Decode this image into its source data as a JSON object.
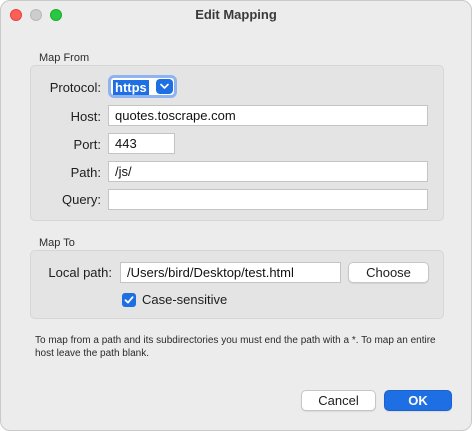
{
  "window": {
    "title": "Edit Mapping"
  },
  "map_from": {
    "section_label": "Map From",
    "protocol": {
      "label": "Protocol:",
      "value": "https"
    },
    "host": {
      "label": "Host:",
      "value": "quotes.toscrape.com"
    },
    "port": {
      "label": "Port:",
      "value": "443"
    },
    "path": {
      "label": "Path:",
      "value": "/js/"
    },
    "query": {
      "label": "Query:",
      "value": ""
    }
  },
  "map_to": {
    "section_label": "Map To",
    "local_path": {
      "label": "Local path:",
      "value": "/Users/bird/Desktop/test.html"
    },
    "choose_label": "Choose",
    "case_sensitive": {
      "label": "Case-sensitive",
      "checked": true
    }
  },
  "note": "To map from a path and its subdirectories you must end the path with a *. To map an entire host leave the path blank.",
  "buttons": {
    "cancel": "Cancel",
    "ok": "OK"
  },
  "colors": {
    "accent": "#1f6fe4",
    "close": "#ff5f57",
    "maximize": "#28c840"
  },
  "icons": {
    "dropdown": "chevron-down-icon",
    "checkbox": "checkmark-icon"
  }
}
